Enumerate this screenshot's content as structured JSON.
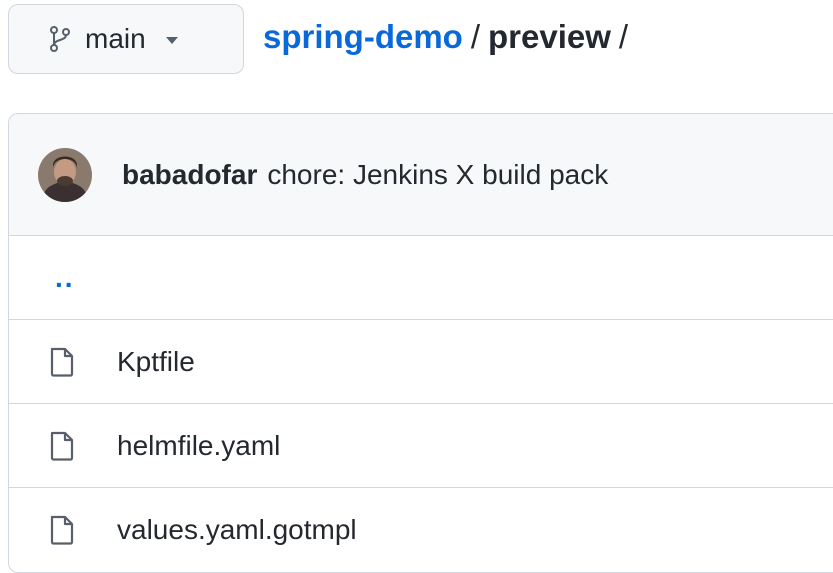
{
  "branch": {
    "icon": "git-branch-icon",
    "label": "main",
    "dropdown_icon": "caret-down-icon"
  },
  "breadcrumb": {
    "repo": "spring-demo",
    "separator": "/",
    "directory": "preview",
    "trailing_separator": "/"
  },
  "latest_commit": {
    "avatar": "user-avatar",
    "author": "babadofar",
    "message": "chore: Jenkins X build pack"
  },
  "files": {
    "parent": "..",
    "items": [
      {
        "icon": "file-icon",
        "name": "Kptfile"
      },
      {
        "icon": "file-icon",
        "name": "helmfile.yaml"
      },
      {
        "icon": "file-icon",
        "name": "values.yaml.gotmpl"
      }
    ]
  },
  "colors": {
    "link": "#0969da",
    "border": "#d0d7de",
    "header_bg": "#f6f8fa",
    "text": "#24292f"
  }
}
